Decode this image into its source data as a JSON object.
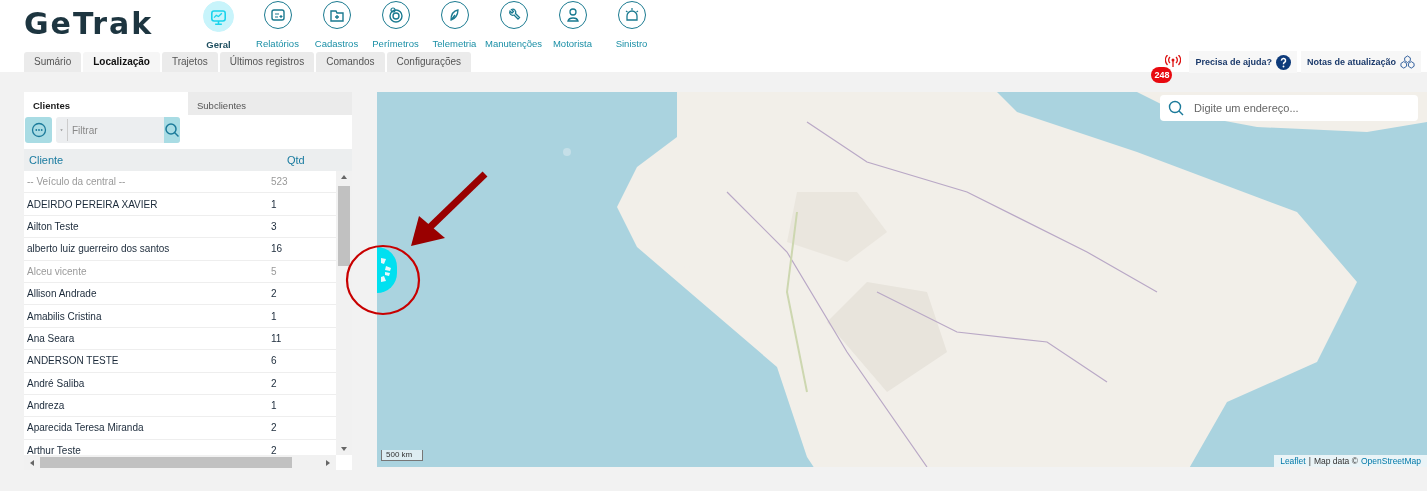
{
  "logo": "GeTrak",
  "nav": [
    {
      "label": "Geral",
      "selected": true
    },
    {
      "label": "Relatórios",
      "selected": false
    },
    {
      "label": "Cadastros",
      "selected": false
    },
    {
      "label": "Perímetros",
      "selected": false
    },
    {
      "label": "Telemetria",
      "selected": false
    },
    {
      "label": "Manutenções",
      "selected": false
    },
    {
      "label": "Motorista",
      "selected": false
    },
    {
      "label": "Sinistro",
      "selected": false
    }
  ],
  "tabs": [
    {
      "label": "Sumário",
      "selected": false
    },
    {
      "label": "Localização",
      "selected": true
    },
    {
      "label": "Trajetos",
      "selected": false
    },
    {
      "label": "Últimos registros",
      "selected": false
    },
    {
      "label": "Comandos",
      "selected": false
    },
    {
      "label": "Configurações",
      "selected": false
    }
  ],
  "alerts": {
    "count": "248"
  },
  "help": {
    "label": "Precisa de ajuda?"
  },
  "updates": {
    "label": "Notas de atualização"
  },
  "panel": {
    "tabs": [
      {
        "label": "Clientes",
        "selected": true
      },
      {
        "label": "Subclientes",
        "selected": false
      }
    ],
    "filter": {
      "placeholder": "Filtrar"
    },
    "columns": [
      "Cliente",
      "Qtd"
    ],
    "rows": [
      {
        "name": "-- Veículo da central --",
        "qtd": "523",
        "muted": true
      },
      {
        "name": "ADEIRDO PEREIRA XAVIER",
        "qtd": "1",
        "muted": false
      },
      {
        "name": "Ailton Teste",
        "qtd": "3",
        "muted": false
      },
      {
        "name": "alberto luiz guerreiro dos santos",
        "qtd": "16",
        "muted": false
      },
      {
        "name": "Alceu vicente",
        "qtd": "5",
        "muted": true
      },
      {
        "name": "Allison Andrade",
        "qtd": "2",
        "muted": false
      },
      {
        "name": "Amabilis Cristina",
        "qtd": "1",
        "muted": false
      },
      {
        "name": "Ana Seara",
        "qtd": "11",
        "muted": false
      },
      {
        "name": "ANDERSON TESTE",
        "qtd": "6",
        "muted": false
      },
      {
        "name": "André Saliba",
        "qtd": "2",
        "muted": false
      },
      {
        "name": "Andreza",
        "qtd": "1",
        "muted": false
      },
      {
        "name": "Aparecida Teresa Miranda",
        "qtd": "2",
        "muted": false
      },
      {
        "name": "Arthur Teste",
        "qtd": "2",
        "muted": false
      }
    ]
  },
  "map": {
    "search": {
      "placeholder": "Digite um endereço..."
    },
    "scale": "500 km",
    "attribution": [
      {
        "text": "Leaflet",
        "kind": "link"
      },
      {
        "text": "|",
        "kind": "text"
      },
      {
        "text": "Map data ©",
        "kind": "text"
      },
      {
        "text": "OpenStreetMap",
        "kind": "link"
      }
    ]
  }
}
